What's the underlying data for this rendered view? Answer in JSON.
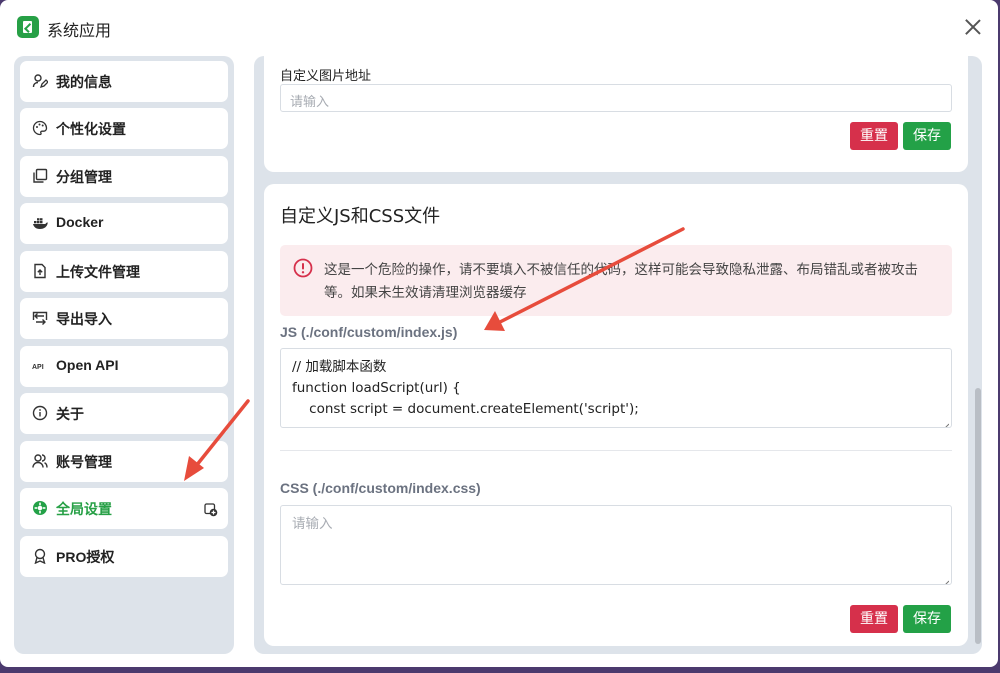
{
  "window": {
    "title": "系统应用"
  },
  "sidebar": {
    "items": [
      {
        "label": "我的信息",
        "icon": "user-edit-icon"
      },
      {
        "label": "个性化设置",
        "icon": "palette-icon"
      },
      {
        "label": "分组管理",
        "icon": "copy-icon"
      },
      {
        "label": "Docker",
        "icon": "docker-icon"
      },
      {
        "label": "上传文件管理",
        "icon": "file-upload-icon"
      },
      {
        "label": "导出导入",
        "icon": "transfer-icon"
      },
      {
        "label": "Open API",
        "icon": "api-icon"
      },
      {
        "label": "关于",
        "icon": "info-icon"
      },
      {
        "label": "账号管理",
        "icon": "users-icon"
      },
      {
        "label": "全局设置",
        "icon": "settings-icon",
        "active": true
      },
      {
        "label": "PRO授权",
        "icon": "award-icon"
      }
    ]
  },
  "custom_image": {
    "label": "自定义图片地址",
    "placeholder": "请输入",
    "reset_label": "重置",
    "save_label": "保存"
  },
  "custom_files": {
    "title": "自定义JS和CSS文件",
    "warning": "这是一个危险的操作，请不要填入不被信任的代码，这样可能会导致隐私泄露、布局错乱或者被攻击等。如果未生效请清理浏览器缓存",
    "js_label": "JS (./conf/custom/index.js)",
    "js_code": [
      "// 加载脚本函数",
      "function loadScript(url) {",
      "    const script = document.createElement('script');"
    ],
    "css_label": "CSS (./conf/custom/index.css)",
    "css_placeholder": "请输入",
    "reset_label": "重置",
    "save_label": "保存"
  },
  "colors": {
    "accent_green": "#23a147",
    "danger_red": "#d6304b",
    "annotation_arrow": "#e74c3c"
  }
}
